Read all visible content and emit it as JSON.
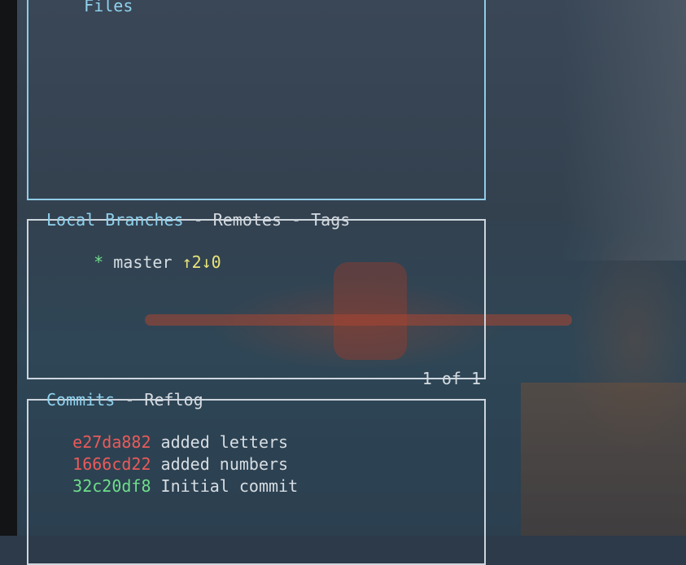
{
  "files_panel": {
    "title": "Files"
  },
  "branches_panel": {
    "tabs": [
      "Local Branches",
      "Remotes",
      "Tags"
    ],
    "separator": " - ",
    "branches": [
      {
        "marker": "*",
        "name": "master",
        "tracking": "↑2↓0"
      }
    ],
    "footer": "1 of 1"
  },
  "commits_panel": {
    "tabs": [
      "Commits",
      "Reflog"
    ],
    "separator": " - ",
    "commits": [
      {
        "hash": "e27da882",
        "message": "added letters",
        "hash_color": "#ea5a5a"
      },
      {
        "hash": "1666cd22",
        "message": "added numbers",
        "hash_color": "#ea5a5a"
      },
      {
        "hash": "32c20df8",
        "message": "Initial commit",
        "hash_color": "#6ede8a"
      }
    ]
  },
  "colors": {
    "active_border": "#8fcde6",
    "inactive_border": "#cdd5dd",
    "tracking": "#e8e47a"
  }
}
